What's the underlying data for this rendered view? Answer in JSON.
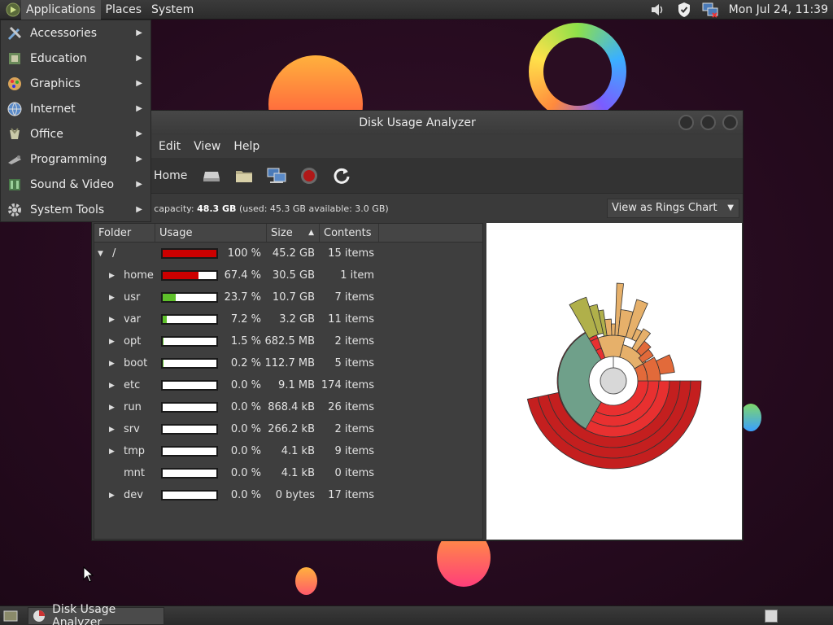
{
  "top_panel": {
    "menus": [
      "Applications",
      "Places",
      "System"
    ],
    "clock": "Mon Jul 24, 11:39",
    "tray_icons": [
      "volume-icon",
      "shield-icon",
      "network-icon"
    ]
  },
  "app_menu": {
    "items": [
      {
        "label": "Accessories",
        "icon": "accessories-icon",
        "color": "#7aa9d8"
      },
      {
        "label": "Education",
        "icon": "education-icon",
        "color": "#8aa27a"
      },
      {
        "label": "Graphics",
        "icon": "graphics-icon",
        "color": "#d8a45a"
      },
      {
        "label": "Internet",
        "icon": "internet-icon",
        "color": "#8ab0d8"
      },
      {
        "label": "Office",
        "icon": "office-icon",
        "color": "#c9c9a8"
      },
      {
        "label": "Programming",
        "icon": "programming-icon",
        "color": "#b0b0b0"
      },
      {
        "label": "Sound & Video",
        "icon": "sound-video-icon",
        "color": "#6fa86f"
      },
      {
        "label": "System Tools",
        "icon": "system-tools-icon",
        "color": "#a8a8a8"
      }
    ]
  },
  "window": {
    "title": "Disk Usage Analyzer",
    "menus": [
      "Edit",
      "View",
      "Help"
    ],
    "toolbar": {
      "home_label": "Home",
      "buttons": [
        "drive-icon",
        "folder-icon",
        "network-icon",
        "stop-icon",
        "refresh-icon"
      ]
    },
    "capacity": {
      "prefix": "m capacity: ",
      "total": "48.3 GB",
      "details": " (used: 45.3 GB available: 3.0 GB)"
    },
    "view_mode": "View as Rings Chart",
    "columns": {
      "folder": "Folder",
      "usage": "Usage",
      "size": "Size",
      "contents": "Contents"
    },
    "rows": [
      {
        "name": "/",
        "expanded": true,
        "level": 0,
        "usage": 1.0,
        "bar_color": "#cc0000",
        "percent": "100 %",
        "size": "45.2 GB",
        "contents": "15 items"
      },
      {
        "name": "home",
        "level": 1,
        "expander": true,
        "usage": 0.674,
        "bar_color": "#cc0000",
        "percent": "67.4 %",
        "size": "30.5 GB",
        "contents": "1 item"
      },
      {
        "name": "usr",
        "level": 1,
        "expander": true,
        "usage": 0.237,
        "bar_color": "#5ec02a",
        "percent": "23.7 %",
        "size": "10.7 GB",
        "contents": "7 items"
      },
      {
        "name": "var",
        "level": 1,
        "expander": true,
        "usage": 0.072,
        "bar_color": "#5ec02a",
        "percent": "7.2 %",
        "size": "3.2 GB",
        "contents": "11 items"
      },
      {
        "name": "opt",
        "level": 1,
        "expander": true,
        "usage": 0.015,
        "bar_color": "#5ec02a",
        "percent": "1.5 %",
        "size": "682.5 MB",
        "contents": "2 items"
      },
      {
        "name": "boot",
        "level": 1,
        "expander": true,
        "usage": 0.002,
        "bar_color": "#5ec02a",
        "percent": "0.2 %",
        "size": "112.7 MB",
        "contents": "5 items"
      },
      {
        "name": "etc",
        "level": 1,
        "expander": true,
        "usage": 0.0,
        "bar_color": "#5ec02a",
        "percent": "0.0 %",
        "size": "9.1 MB",
        "contents": "174 items"
      },
      {
        "name": "run",
        "level": 1,
        "expander": true,
        "usage": 0.0,
        "bar_color": "#5ec02a",
        "percent": "0.0 %",
        "size": "868.4 kB",
        "contents": "26 items"
      },
      {
        "name": "srv",
        "level": 1,
        "expander": true,
        "usage": 0.0,
        "bar_color": "#5ec02a",
        "percent": "0.0 %",
        "size": "266.2 kB",
        "contents": "2 items"
      },
      {
        "name": "tmp",
        "level": 1,
        "expander": true,
        "usage": 0.0,
        "bar_color": "#5ec02a",
        "percent": "0.0 %",
        "size": "4.1 kB",
        "contents": "9 items"
      },
      {
        "name": "mnt",
        "level": 1,
        "expander": false,
        "usage": 0.0,
        "bar_color": "#5ec02a",
        "percent": "0.0 %",
        "size": "4.1 kB",
        "contents": "0 items"
      },
      {
        "name": "dev",
        "level": 1,
        "expander": true,
        "usage": 0.0,
        "bar_color": "#5ec02a",
        "percent": "0.0 %",
        "size": "0 bytes",
        "contents": "17 items"
      }
    ]
  },
  "taskbar": {
    "task_label": "Disk Usage Analyzer"
  },
  "colors": {
    "accent": "#cc0000",
    "usage_green": "#5ec02a",
    "ring_red": "#e83030",
    "ring_dark_red": "#c41f1f",
    "ring_orange": "#e26a3a",
    "ring_teal": "#6fa08a",
    "ring_tan": "#e6b06a",
    "ring_olive": "#b0b04a",
    "ring_center": "#d8d8d8"
  }
}
